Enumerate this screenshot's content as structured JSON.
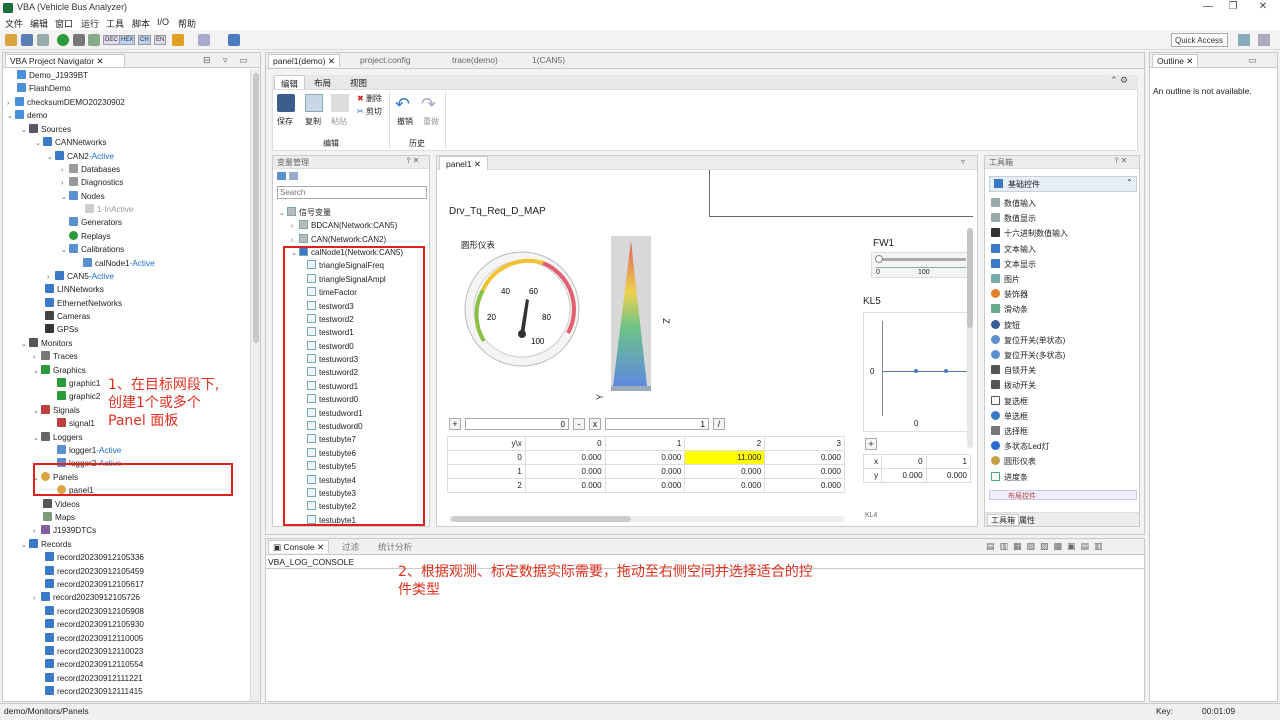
{
  "window": {
    "title": "VBA (Vehicle Bus Analyzer)",
    "min": "—",
    "max": "❐",
    "close": "✕"
  },
  "menu": [
    "文件",
    "编辑",
    "窗口",
    "运行",
    "工具",
    "脚本",
    "I/O",
    "帮助"
  ],
  "toolbar": {
    "dec": "DEC",
    "hex": "HEX",
    "ch": "CH",
    "en": "EN",
    "quick_access": "Quick Access"
  },
  "navigator": {
    "title": "VBA Project Navigator",
    "tree": [
      {
        "label": "Demo_J1939BT"
      },
      {
        "label": "FlashDemo"
      },
      {
        "label": "checksumDEMO20230902"
      },
      {
        "label": "demo"
      },
      {
        "label": "Sources"
      },
      {
        "label": "CANNetworks"
      },
      {
        "label": "CAN2",
        "status": "-Active"
      },
      {
        "label": "Databases"
      },
      {
        "label": "Diagnostics"
      },
      {
        "label": "Nodes"
      },
      {
        "label": "1-InActive"
      },
      {
        "label": "Generators"
      },
      {
        "label": "Replays"
      },
      {
        "label": "Calibrations"
      },
      {
        "label": "calNode1",
        "status": "-Active"
      },
      {
        "label": "CAN5",
        "status": "-Active"
      },
      {
        "label": "LINNetworks"
      },
      {
        "label": "EthernetNetworks"
      },
      {
        "label": "Cameras"
      },
      {
        "label": "GPSs"
      },
      {
        "label": "Monitors"
      },
      {
        "label": "Traces"
      },
      {
        "label": "Graphics"
      },
      {
        "label": "graphic1"
      },
      {
        "label": "graphic2"
      },
      {
        "label": "Signals"
      },
      {
        "label": "signal1"
      },
      {
        "label": "Loggers"
      },
      {
        "label": "logger1",
        "status": "-Active"
      },
      {
        "label": "logger2",
        "status": "-Active"
      },
      {
        "label": "Panels"
      },
      {
        "label": "panel1"
      },
      {
        "label": "Videos"
      },
      {
        "label": "Maps"
      },
      {
        "label": "J1939DTCs"
      },
      {
        "label": "Records"
      },
      {
        "label": "record20230912105336"
      },
      {
        "label": "record20230912105459"
      },
      {
        "label": "record20230912105617"
      },
      {
        "label": "record20230912105726"
      },
      {
        "label": "record20230912105908"
      },
      {
        "label": "record20230912105930"
      },
      {
        "label": "record20230912110005"
      },
      {
        "label": "record20230912110023"
      },
      {
        "label": "record20230912110554"
      },
      {
        "label": "record20230912111221"
      },
      {
        "label": "record20230912111415"
      }
    ]
  },
  "annotations": {
    "step1": "1、在目标网段下,\n创建1个或多个\nPanel 面板",
    "step2": "2、根据观测、标定数据实际需要，拖动至右侧空间并选择适合的控\n件类型"
  },
  "editor": {
    "tabs": [
      {
        "label": "panel1(demo)"
      },
      {
        "label": "project.config"
      },
      {
        "label": "trace(demo)"
      },
      {
        "label": "1(CAN5)"
      }
    ],
    "ribbon_tabs": [
      "编辑",
      "布局",
      "视图"
    ],
    "ribbon": {
      "save": "保存",
      "copy": "复制",
      "paste": "粘贴",
      "delete": "删除",
      "cut": "剪切",
      "undo": "撤销",
      "redo": "重做",
      "group_edit": "编辑",
      "group_history": "历史"
    }
  },
  "var_mgmt": {
    "title": "变量管理",
    "search_placeholder": "Search",
    "root": "信号变量",
    "groups": [
      "BDCAN(Network:CAN5)",
      "CAN(Network:CAN2)",
      "calNode1(Network:CAN5)"
    ],
    "signals": [
      "triangleSignalFreq",
      "triangleSignalAmpl",
      "timeFactor",
      "testword3",
      "testword2",
      "testword1",
      "testword0",
      "testuword3",
      "testuword2",
      "testuword1",
      "testuword0",
      "testudword1",
      "testudword0",
      "testubyte7",
      "testubyte6",
      "testubyte5",
      "testubyte4",
      "testubyte3",
      "testubyte2",
      "testubyte1"
    ]
  },
  "panel": {
    "tab": "panel1",
    "map_title": "Drv_Tq_Req_D_MAP",
    "gauge_title": "圆形仪表",
    "gauge_ticks": [
      "20",
      "40",
      "60",
      "80",
      "100"
    ],
    "axis_z": "Z",
    "axis_y": "Y",
    "x_input": "0",
    "y_input": "1",
    "plus": "+",
    "minus": "-",
    "mult": "x",
    "div": "/",
    "table_header": [
      "y\\x",
      "0",
      "1",
      "2",
      "3"
    ],
    "table_rows": [
      [
        "0",
        "0.000",
        "0.000",
        "11.000",
        "0.000"
      ],
      [
        "1",
        "0.000",
        "0.000",
        "0.000",
        "0.000"
      ],
      [
        "2",
        "0.000",
        "0.000",
        "0.000",
        "0.000"
      ]
    ],
    "fw_label": "FW1",
    "fw_ticks": [
      "0",
      "100"
    ],
    "kl_label": "KL5",
    "kl_y0": "0",
    "kl_x0": "0",
    "kl_bottom": "KL4",
    "kl_table": {
      "x_label": "x",
      "y_label": "y",
      "x": [
        "0",
        "1"
      ],
      "y": [
        "0.000",
        "0.000"
      ]
    }
  },
  "toolbox": {
    "title": "工具箱",
    "section": "基础控件",
    "items": [
      "数值输入",
      "数值显示",
      "十六进制数值输入",
      "文本输入",
      "文本显示",
      "图片",
      "装饰器",
      "滑动条",
      "旋钮",
      "复位开关(单状态)",
      "复位开关(多状态)",
      "自锁开关",
      "拨动开关",
      "复选框",
      "单选框",
      "选择框",
      "多状态Led灯",
      "圆形仪表",
      "进度条",
      "布局控件"
    ],
    "bottom_tabs": [
      "工具箱",
      "属性"
    ]
  },
  "outline": {
    "title": "Outline",
    "message": "An outline is not available."
  },
  "console": {
    "tabs": [
      "Console",
      "过滤",
      "统计分析"
    ],
    "log_name": "VBA_LOG_CONSOLE"
  },
  "status": {
    "path": "demo/Monitors/Panels",
    "key": "Key:",
    "time": "00:01:09"
  }
}
